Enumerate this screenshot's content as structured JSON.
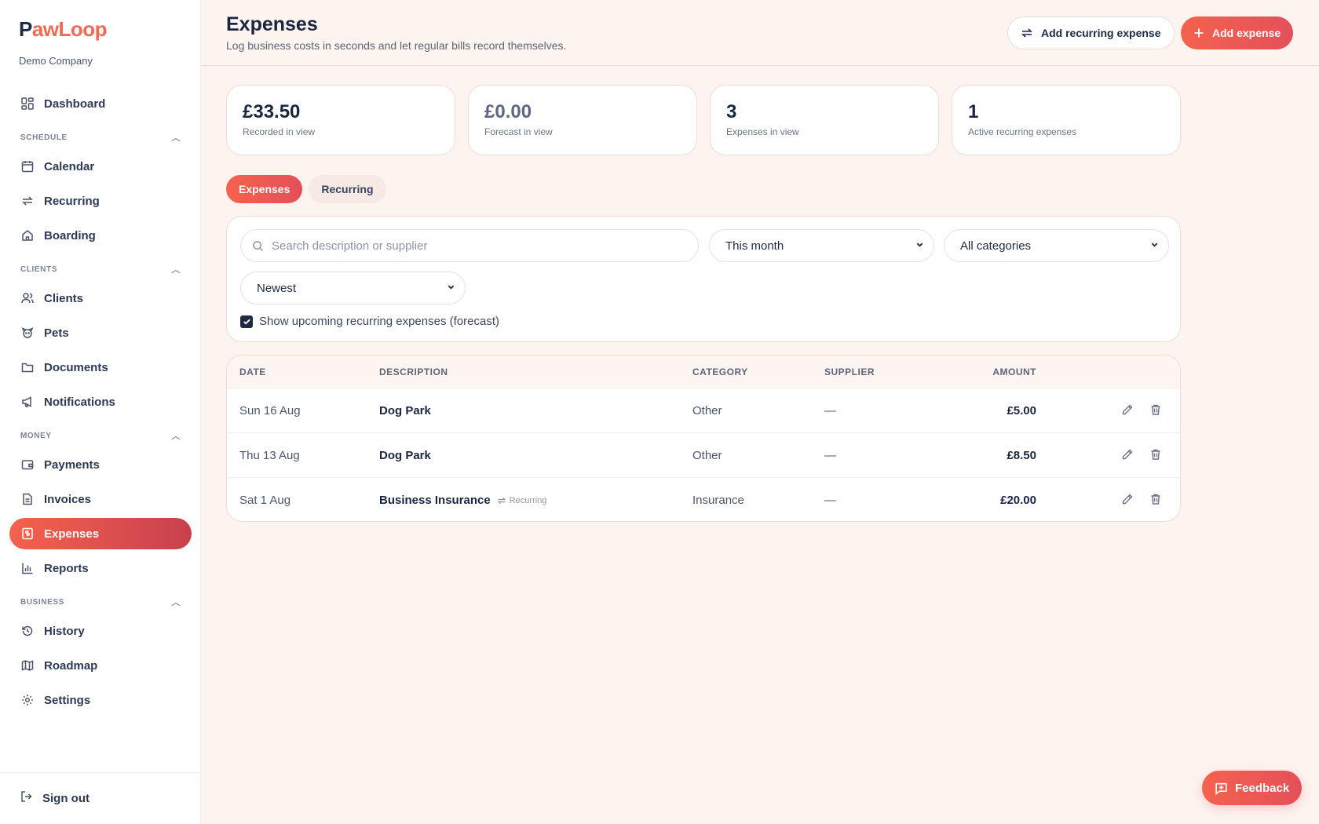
{
  "brand": {
    "logo_initial": "P",
    "logo_rest": "awLoop",
    "company": "Demo Company"
  },
  "sidebar": {
    "dashboard": "Dashboard",
    "sections": {
      "schedule": "SCHEDULE",
      "clients": "CLIENTS",
      "money": "MONEY",
      "business": "BUSINESS"
    },
    "items": {
      "calendar": "Calendar",
      "recurring": "Recurring",
      "boarding": "Boarding",
      "clients": "Clients",
      "pets": "Pets",
      "documents": "Documents",
      "notifications": "Notifications",
      "payments": "Payments",
      "invoices": "Invoices",
      "expenses": "Expenses",
      "reports": "Reports",
      "history": "History",
      "roadmap": "Roadmap",
      "settings": "Settings"
    },
    "sign_out": "Sign out"
  },
  "header": {
    "title": "Expenses",
    "subtitle": "Log business costs in seconds and let regular bills record themselves.",
    "add_recurring": "Add recurring expense",
    "add_expense": "Add expense"
  },
  "stats": [
    {
      "value": "£33.50",
      "label": "Recorded in view"
    },
    {
      "value": "£0.00",
      "label": "Forecast in view"
    },
    {
      "value": "3",
      "label": "Expenses in view"
    },
    {
      "value": "1",
      "label": "Active recurring expenses"
    }
  ],
  "tabs": {
    "expenses": "Expenses",
    "recurring": "Recurring"
  },
  "filters": {
    "search_placeholder": "Search description or supplier",
    "period": "This month",
    "category": "All categories",
    "sort": "Newest",
    "forecast_label": "Show upcoming recurring expenses (forecast)",
    "forecast_checked": true
  },
  "table": {
    "headers": {
      "date": "DATE",
      "description": "DESCRIPTION",
      "category": "CATEGORY",
      "supplier": "SUPPLIER",
      "amount": "AMOUNT"
    },
    "rows": [
      {
        "date": "Sun 16 Aug",
        "description": "Dog Park",
        "badge": "",
        "category": "Other",
        "supplier": "—",
        "amount": "£5.00"
      },
      {
        "date": "Thu 13 Aug",
        "description": "Dog Park",
        "badge": "",
        "category": "Other",
        "supplier": "—",
        "amount": "£8.50"
      },
      {
        "date": "Sat 1 Aug",
        "description": "Business Insurance",
        "badge": "Recurring",
        "category": "Insurance",
        "supplier": "—",
        "amount": "£20.00"
      }
    ]
  },
  "feedback": "Feedback",
  "colors": {
    "accent": "#f5624d",
    "accent_dark": "#c8404e",
    "background": "#fdf3ef",
    "text": "#1e2a44"
  }
}
